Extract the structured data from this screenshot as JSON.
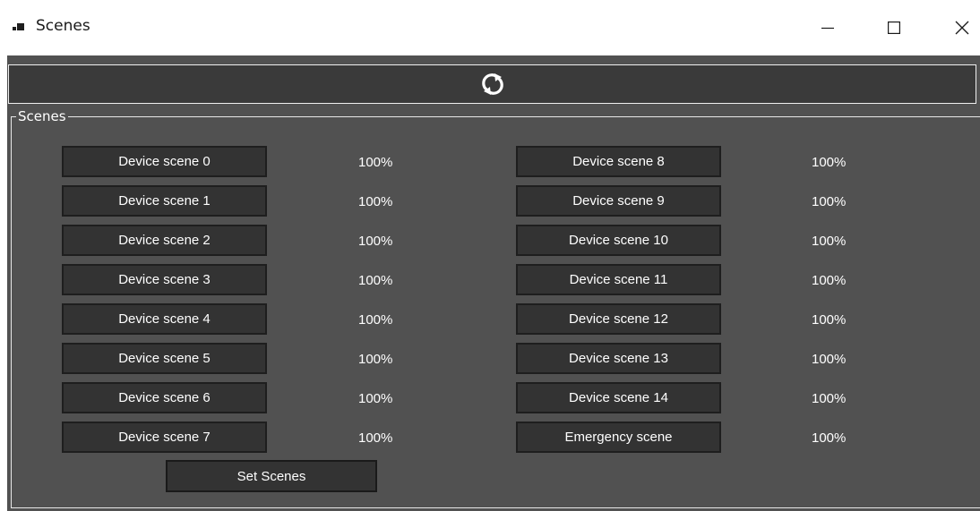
{
  "window": {
    "title": "Scenes",
    "controls": [
      "minimize",
      "maximize",
      "close"
    ]
  },
  "toolbar": {
    "refresh_icon": "refresh-icon"
  },
  "group": {
    "label": "Scenes"
  },
  "scenes_left": [
    {
      "label": "Device scene 0",
      "value": "100%"
    },
    {
      "label": "Device scene 1",
      "value": "100%"
    },
    {
      "label": "Device scene 2",
      "value": "100%"
    },
    {
      "label": "Device scene 3",
      "value": "100%"
    },
    {
      "label": "Device scene 4",
      "value": "100%"
    },
    {
      "label": "Device scene 5",
      "value": "100%"
    },
    {
      "label": "Device scene 6",
      "value": "100%"
    },
    {
      "label": "Device scene 7",
      "value": "100%"
    }
  ],
  "scenes_right": [
    {
      "label": "Device scene 8",
      "value": "100%"
    },
    {
      "label": "Device scene 9",
      "value": "100%"
    },
    {
      "label": "Device scene 10",
      "value": "100%"
    },
    {
      "label": "Device scene 11",
      "value": "100%"
    },
    {
      "label": "Device scene 12",
      "value": "100%"
    },
    {
      "label": "Device scene 13",
      "value": "100%"
    },
    {
      "label": "Device scene 14",
      "value": "100%"
    },
    {
      "label": "Emergency scene",
      "value": "100%"
    }
  ],
  "actions": {
    "set_label": "Set Scenes"
  },
  "colors": {
    "client_bg": "#515151",
    "button_bg": "#333333",
    "refresh_bar_bg": "#3a3a3a",
    "text": "#ffffff"
  }
}
